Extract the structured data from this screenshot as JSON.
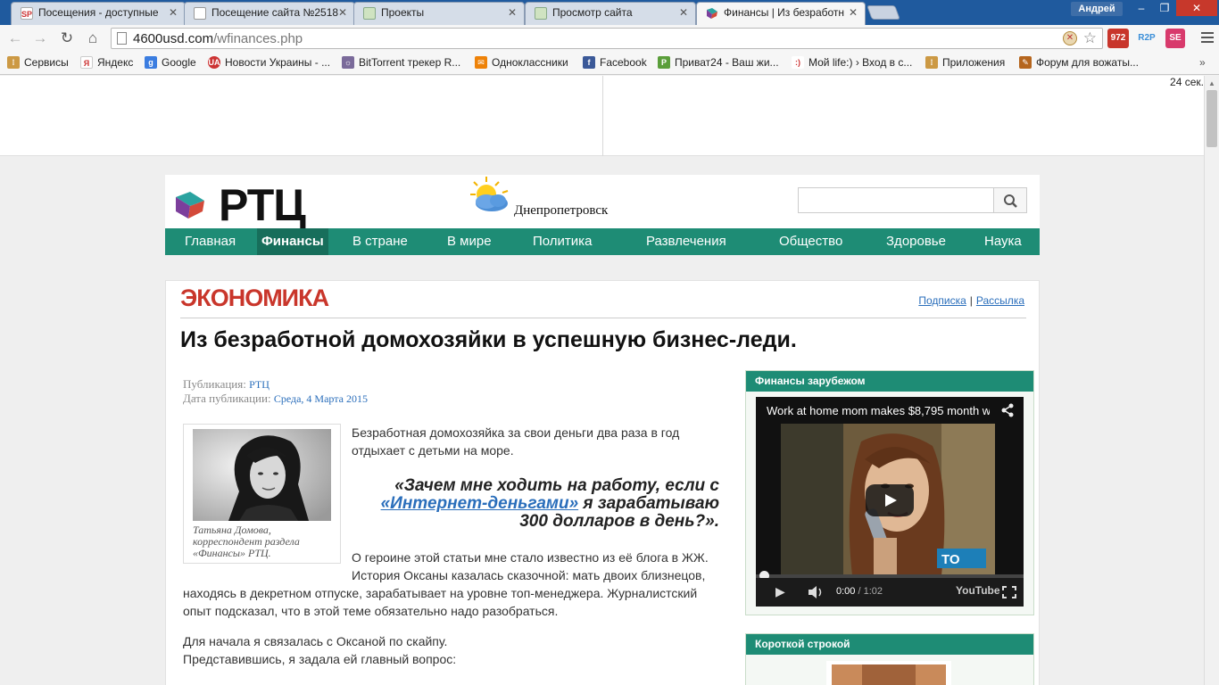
{
  "browser": {
    "tabs": [
      {
        "title": "Посещения - доступные",
        "favicon": "SP"
      },
      {
        "title": "Посещение сайта №2518",
        "favicon": ""
      },
      {
        "title": "Проекты",
        "favicon": ""
      },
      {
        "title": "Просмотр сайта",
        "favicon": ""
      },
      {
        "title": "Финансы | Из безработн",
        "favicon": ""
      }
    ],
    "active_tab": 4,
    "user_name": "Андрей",
    "url_host": "4600usd.com",
    "url_path": "/wfinances.php",
    "extensions": [
      "972",
      "R2P",
      "SE"
    ],
    "bookmarks": [
      {
        "label": "Сервисы",
        "icon": "apps-icon"
      },
      {
        "label": "Яндекс",
        "icon": "yandex-icon"
      },
      {
        "label": "Google",
        "icon": "google-icon"
      },
      {
        "label": "Новости Украины - ...",
        "icon": "news-icon"
      },
      {
        "label": "BitTorrent трекер R...",
        "icon": "torrent-icon"
      },
      {
        "label": "Одноклассники",
        "icon": "ok-icon"
      },
      {
        "label": "Facebook",
        "icon": "facebook-icon"
      },
      {
        "label": "Приват24 - Ваш жи...",
        "icon": "privat-icon"
      },
      {
        "label": "Мой life:) › Вход в с...",
        "icon": "life-icon"
      },
      {
        "label": "Приложения",
        "icon": "apps-icon"
      },
      {
        "label": "Форум для вожаты...",
        "icon": "forum-icon"
      }
    ],
    "more_bookmarks": "»"
  },
  "page": {
    "timer": "24 сек.",
    "logo_text": "РТЦ",
    "city": "Днепропетровск",
    "nav": [
      "Главная",
      "Финансы",
      "В стране",
      "В мире",
      "Политика",
      "Развлечения",
      "Общество",
      "Здоровье",
      "Наука"
    ],
    "nav_active": 1,
    "section": "ЭКОНОМИКА",
    "links": {
      "subscribe": "Подписка",
      "sep": "|",
      "mailing": "Рассылка"
    },
    "article": {
      "title": "Из безработной домохозяйки в успешную бизнес-леди.",
      "pub_label": "Публикация:",
      "pub_value": "РТЦ",
      "date_label": "Дата публикации:",
      "date_value": "Среда, 4 Марта 2015",
      "caption": "Татьяна Домова, корреспондент раздела «Финансы» РТЦ.",
      "lead": "Безработная домохозяйка за свои деньги два раза в год отдыхает с детьми на море.",
      "quote_pre": "«Зачем мне ходить на работу, если с ",
      "quote_link": "«Интернет-деньгами»",
      "quote_post": " я зарабатываю 300 долларов в день?».",
      "para1_a": "О героине этой статьи мне стало известно из её блога в ЖЖ. История Оксаны казалась сказочной: мать двоих близнецов,",
      "para1_b": "находясь в декретном отпуске, зарабатывает на уровне топ-менеджера. Журналистский опыт подсказал, что в этой теме обязательно надо разобраться.",
      "para2": "Для начала я связалась с Оксаной по скайпу.",
      "para3": "Представившись, я задала ей главный вопрос:"
    },
    "sidebar": {
      "box1_title": "Финансы зарубежом",
      "video_title": "Work at home mom makes $8,795 month w",
      "video_time": "0:00",
      "video_duration": "/ 1:02",
      "video_progress": 0,
      "yt_label": "YouTube",
      "box2_title": "Короткой строкой"
    }
  },
  "colors": {
    "nav_bg": "#1e8c75",
    "section_red": "#c9362b",
    "link_blue": "#2a6ebb"
  }
}
